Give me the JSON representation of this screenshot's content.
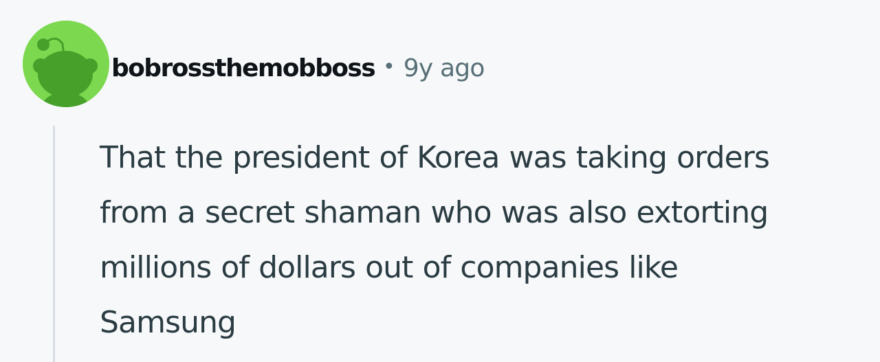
{
  "comment": {
    "avatar_icon": "reddit-snoo-avatar-icon",
    "avatar_color": "#7bd84f",
    "username": "bobrossthemobboss",
    "separator": "•",
    "timestamp": "9y ago",
    "body_lines": [
      "That the president of Korea was taking orders",
      "from a secret shaman who was also extorting",
      "millions of dollars out of companies like",
      "Samsung"
    ]
  }
}
